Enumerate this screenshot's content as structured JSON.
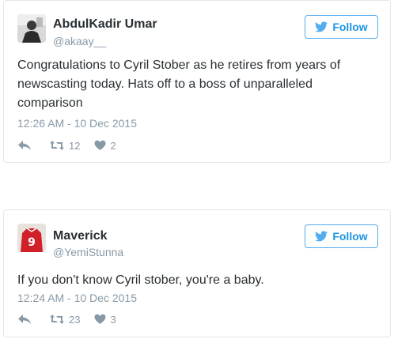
{
  "follow_label": "Follow",
  "colors": {
    "twitter_blue": "#55acee",
    "text": "#292f33",
    "muted": "#8899a6",
    "border": "#e1e8ed"
  },
  "tweets": [
    {
      "name": "AbdulKadir Umar",
      "handle": "@akaay__",
      "text": "Congratulations to Cyril Stober as he retires from years of newscasting today. Hats off to a boss of unparalleled comparison",
      "timestamp": "12:26 AM - 10 Dec 2015",
      "retweets": "12",
      "likes": "2"
    },
    {
      "name": "Maverick",
      "handle": "@YemiStunna",
      "text": "If you don't know Cyril stober, you're a baby.",
      "timestamp": "12:24 AM - 10 Dec 2015",
      "retweets": "23",
      "likes": "3"
    }
  ]
}
